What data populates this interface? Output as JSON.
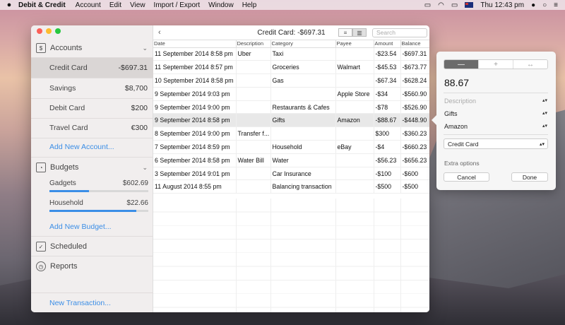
{
  "menubar": {
    "apple": "",
    "app_name": "Debit & Credit",
    "menus": [
      "Account",
      "Edit",
      "View",
      "Import / Export",
      "Window",
      "Help"
    ],
    "clock": "Thu 12:43 pm"
  },
  "sidebar": {
    "accounts_label": "Accounts",
    "accounts": [
      {
        "name": "Credit Card",
        "amount": "-$697.31",
        "selected": true
      },
      {
        "name": "Savings",
        "amount": "$8,700"
      },
      {
        "name": "Debit Card",
        "amount": "$200"
      },
      {
        "name": "Travel Card",
        "amount": "€300"
      }
    ],
    "add_account": "Add New Account...",
    "budgets_label": "Budgets",
    "budgets": [
      {
        "name": "Gadgets",
        "amount": "$602.69",
        "progress": 0.4
      },
      {
        "name": "Household",
        "amount": "$22.66",
        "progress": 0.88
      }
    ],
    "add_budget": "Add New Budget...",
    "scheduled_label": "Scheduled",
    "reports_label": "Reports",
    "new_transaction": "New Transaction..."
  },
  "main": {
    "title": "Credit Card: -$697.31",
    "search_placeholder": "Search",
    "columns": [
      "Date",
      "Description",
      "Category",
      "Payee",
      "Amount",
      "Balance"
    ],
    "rows": [
      [
        "11 September 2014 8:58 pm",
        "Uber",
        "Taxi",
        "",
        "-$23.54",
        "-$697.31"
      ],
      [
        "11 September 2014 8:57 pm",
        "",
        "Groceries",
        "Walmart",
        "-$45.53",
        "-$673.77"
      ],
      [
        "10 September 2014 8:58 pm",
        "",
        "Gas",
        "",
        "-$67.34",
        "-$628.24"
      ],
      [
        "9 September 2014 9:03 pm",
        "",
        "",
        "Apple Store",
        "-$34",
        "-$560.90"
      ],
      [
        "9 September 2014 9:00 pm",
        "",
        "Restaurants & Cafes",
        "",
        "-$78",
        "-$526.90"
      ],
      [
        "9 September 2014 8:58 pm",
        "",
        "Gifts",
        "Amazon",
        "-$88.67",
        "-$448.90"
      ],
      [
        "8 September 2014 9:00 pm",
        "Transfer f...",
        "",
        "",
        "$300",
        "-$360.23"
      ],
      [
        "7 September 2014 8:59 pm",
        "",
        "Household",
        "eBay",
        "-$4",
        "-$660.23"
      ],
      [
        "6 September 2014 8:58 pm",
        "Water Bill",
        "Water",
        "",
        "-$56.23",
        "-$656.23"
      ],
      [
        "3 September 2014 9:01 pm",
        "",
        "Car Insurance",
        "",
        "-$100",
        "-$600"
      ],
      [
        "11 August 2014 8:55 pm",
        "",
        "Balancing transaction",
        "",
        "-$500",
        "-$500"
      ]
    ],
    "selected_row": 5
  },
  "popover": {
    "segments": [
      "—",
      "+",
      "↔"
    ],
    "amount": "88.67",
    "description_placeholder": "Description",
    "category": "Gifts",
    "payee": "Amazon",
    "account": "Credit Card",
    "extra_options": "Extra options",
    "cancel": "Cancel",
    "done": "Done"
  }
}
